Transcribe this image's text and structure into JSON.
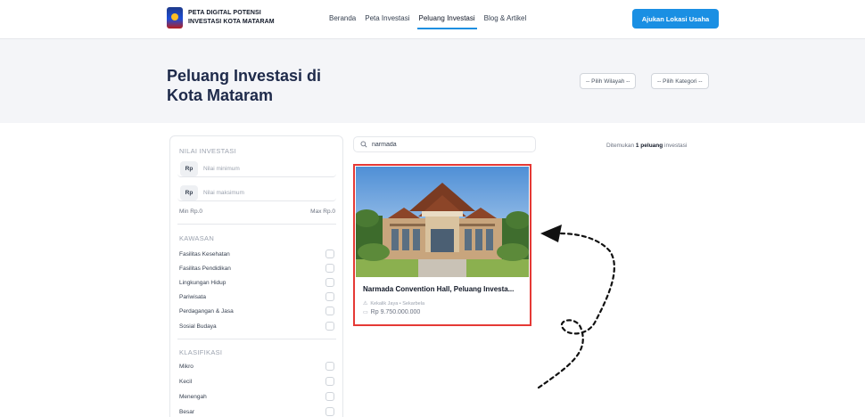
{
  "header": {
    "logo_line1": "PETA DIGITAL POTENSI",
    "logo_line2": "INVESTASI KOTA MATARAM",
    "nav": [
      "Beranda",
      "Peta Investasi",
      "Peluang Investasi",
      "Blog & Artikel"
    ],
    "active_nav": "Peluang Investasi",
    "cta_label": "Ajukan Lokasi Usaha"
  },
  "hero": {
    "title_line1": "Peluang Investasi di",
    "title_line2": "Kota Mataram",
    "wilayah_select": "-- Pilih Wilayah --",
    "kategori_select": "-- Pilih Kategori --"
  },
  "sidebar": {
    "nilai_title": "NILAI INVESTASI",
    "rp_tag": "Rp",
    "min_placeholder": "Nilai minimum",
    "max_placeholder": "Nilai maksimum",
    "min_label": "Min Rp.0",
    "max_label": "Max Rp.0",
    "kawasan_title": "KAWASAN",
    "kawasan": [
      "Fasilitas Kesehatan",
      "Fasilitas Pendidikan",
      "Lingkungan Hidup",
      "Pariwisata",
      "Perdagangan & Jasa",
      "Sosial Budaya"
    ],
    "klasifikasi_title": "KLASIFIKASI",
    "klasifikasi": [
      "Mikro",
      "Kecil",
      "Menengah",
      "Besar"
    ]
  },
  "search": {
    "value": "narmada"
  },
  "results": {
    "prefix": "Ditemukan",
    "count_text": "1 peluang",
    "suffix": "investasi"
  },
  "card": {
    "title": "Narmada Convention Hall, Peluang Investa...",
    "location": "Kekalik Jaya • Sekarbela",
    "price": "Rp 9.750.000.000"
  },
  "colors": {
    "accent": "#1a8fe3",
    "highlight_border": "#e53935",
    "hero_bg": "#f4f5f8"
  }
}
